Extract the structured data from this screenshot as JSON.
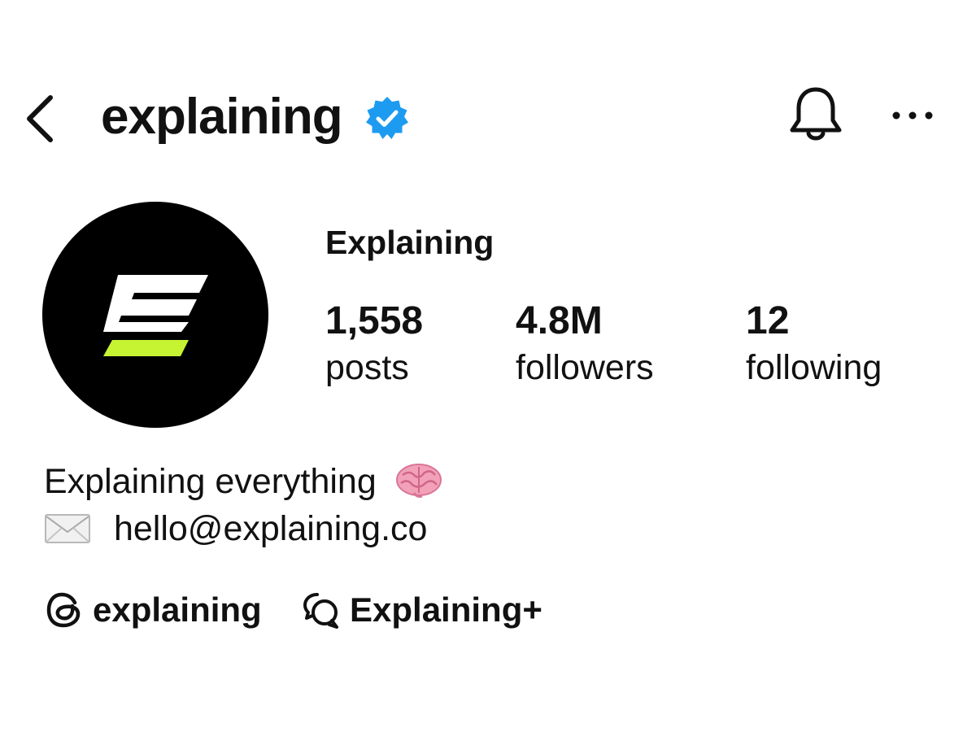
{
  "header": {
    "back_icon": "chevron-left-icon",
    "username": "explaining",
    "verified_icon": "verified-badge-icon",
    "notification_icon": "bell-icon",
    "more_icon": "more-horizontal-icon"
  },
  "profile": {
    "display_name": "Explaining",
    "avatar_icon": "explaining-logo",
    "stats": [
      {
        "count": "1,558",
        "label": "posts"
      },
      {
        "count": "4.8M",
        "label": "followers"
      },
      {
        "count": "12",
        "label": "following"
      }
    ],
    "bio": {
      "line1": "Explaining everything",
      "line1_emoji_icon": "brain-emoji-icon",
      "line2_emoji_icon": "envelope-emoji-icon",
      "email": "hello@explaining.co"
    },
    "links": [
      {
        "icon": "threads-icon",
        "label": "explaining"
      },
      {
        "icon": "broadcast-channel-icon",
        "label": "Explaining+"
      }
    ]
  },
  "colors": {
    "verified_blue": "#1d9bf0",
    "brand_green": "#c6f432",
    "text": "#111111",
    "background": "#ffffff"
  }
}
